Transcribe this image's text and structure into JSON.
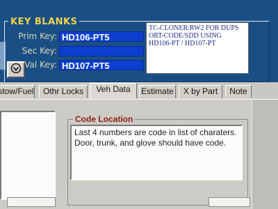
{
  "key_blanks": {
    "title": "KEY BLANKS",
    "prim_key": {
      "label": "Prim Key:",
      "value": "HD106-PT5"
    },
    "sec_key": {
      "label": "Sec Key:",
      "value": ""
    },
    "val_key": {
      "label": "Val Key:",
      "value": "HD107-PT5"
    },
    "notes": "TC-CLONER/RW2 FOR DUPS\nORT-CODE/SDD USING\nHD106-PT / HD107-PT"
  },
  "icon_button": {
    "icon": "key-check-icon"
  },
  "tabs": [
    {
      "label": "stow/Fuel",
      "active": false
    },
    {
      "label": "Othr Locks",
      "active": false
    },
    {
      "label": "Veh Data",
      "active": true
    },
    {
      "label": "Estimate",
      "active": false
    },
    {
      "label": "X by Part",
      "active": false
    },
    {
      "label": "Note",
      "active": false
    }
  ],
  "code_location": {
    "title": "Code Location",
    "text": "Last 4 numbers are code in list of charaters.\nDoor, trunk, and glove should have code."
  },
  "colors": {
    "panel_bg": "#1a4f86",
    "title_yellow": "#f2d24a",
    "field_blue": "#0c3fcf",
    "code_title_red": "#8a1f14"
  }
}
